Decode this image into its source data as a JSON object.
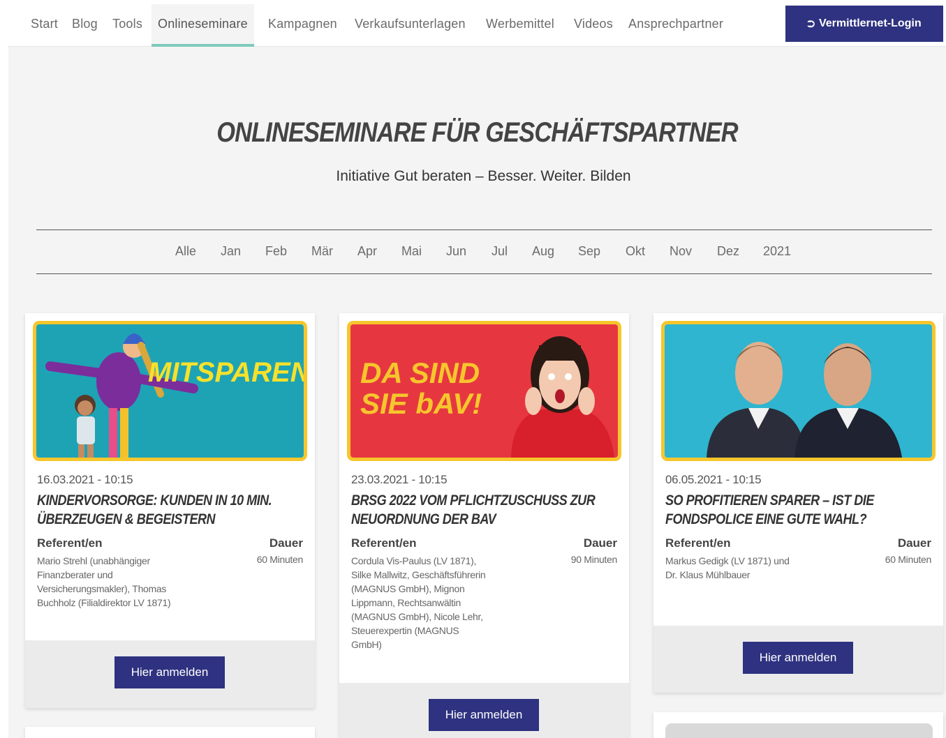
{
  "nav": {
    "items": [
      {
        "label": "Start"
      },
      {
        "label": "Blog"
      },
      {
        "label": "Tools"
      },
      {
        "label": "Onlineseminare",
        "active": true
      },
      {
        "label": "Kampagnen"
      },
      {
        "label": "Verkaufsunterlagen"
      },
      {
        "label": "Werbemittel"
      },
      {
        "label": "Videos"
      },
      {
        "label": "Ansprechpartner"
      }
    ],
    "login_label": "Vermittlernet-Login",
    "login_icon": "login-arrow-icon"
  },
  "hero": {
    "title": "ONLINESEMINARE FÜR GESCHÄFTSPARTNER",
    "subtitle": "Initiative Gut beraten – Besser. Weiter. Bilden"
  },
  "months": [
    "Alle",
    "Jan",
    "Feb",
    "Mär",
    "Apr",
    "Mai",
    "Jun",
    "Jul",
    "Aug",
    "Sep",
    "Okt",
    "Nov",
    "Dez",
    "2021"
  ],
  "cards": [
    {
      "image_text": "MITSPAREN",
      "date": "16.03.2021 - 10:15",
      "title": "Kindervorsorge: Kunden in 10 Min. überzeugen & begeistern",
      "ref_label": "Referent/en",
      "dur_label": "Dauer",
      "referents": "Mario Strehl (unabhängiger Finanzberater und Versicherungsmakler), Thomas Buchholz (Filialdirektor LV 1871)",
      "duration": "60 Minuten",
      "cta": "Hier anmelden"
    },
    {
      "image_text": "DA SIND SIE bAV!",
      "date": "23.03.2021 - 10:15",
      "title": "BRSG 2022 vom Pflichtzuschuss zur Neuordnung der bAV",
      "ref_label": "Referent/en",
      "dur_label": "Dauer",
      "referents": "Cordula Vis-Paulus (LV 1871), Silke Mallwitz, Geschäftsführerin (MAGNUS GmbH), Mignon Lippmann, Rechtsanwältin (MAGNUS GmbH), Nicole Lehr, Steuerexpertin (MAGNUS GmbH)",
      "duration": "90 Minuten",
      "cta": "Hier anmelden"
    },
    {
      "image_text": "",
      "date": "06.05.2021 - 10:15",
      "title": "So profitieren Sparer – Ist die Fondspolice eine gute Wahl?",
      "ref_label": "Referent/en",
      "dur_label": "Dauer",
      "referents": "Markus Gedigk (LV 1871) und Dr. Klaus Mühlbauer",
      "duration": "60 Minuten",
      "cta": "Hier anmelden"
    }
  ],
  "colors": {
    "primary": "#2e3280",
    "nav_active_underline": "#7fc9bb",
    "card_image_border": "#f6c62c"
  }
}
